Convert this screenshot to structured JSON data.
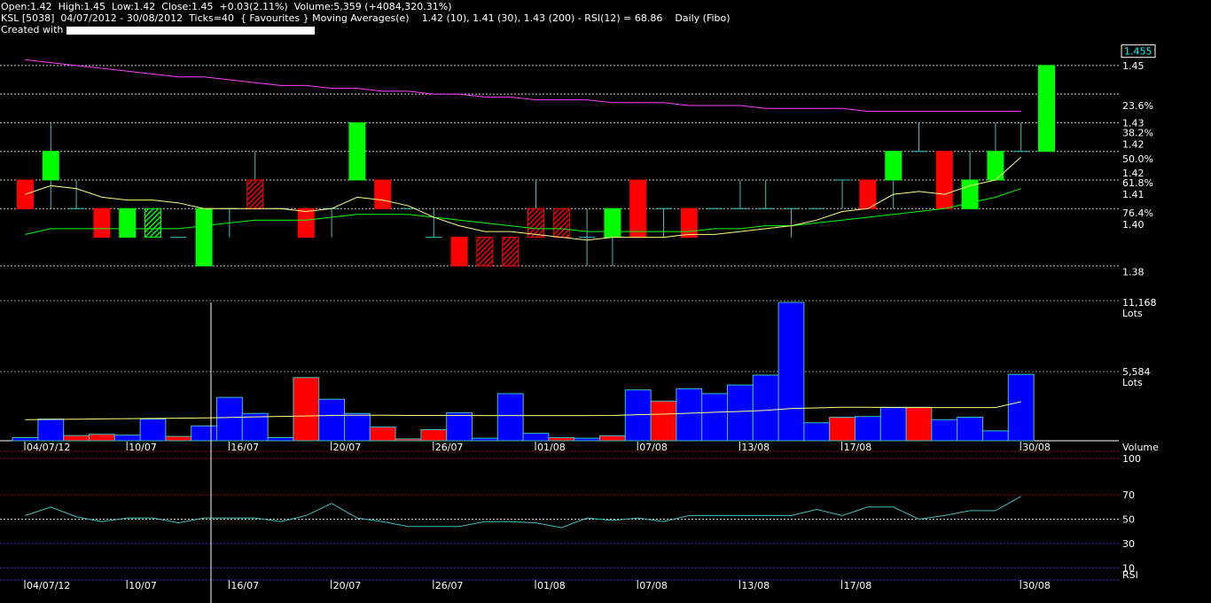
{
  "header": {
    "line1": "Open:1.42  High:1.45  Low:1.42  Close:1.45  +0.03(2.11%)  Volume:5,359 (+4084,320.31%)",
    "line2": "KSL [5038]  04/07/2012 - 30/08/2012  Ticks=40  { Favourites } Moving Averages(e)    1.42 (10), 1.41 (30), 1.43 (200) - RSI(12) = 68.86    Daily (Fibo)",
    "line3": "Created with"
  },
  "colors": {
    "up": "#00ff00",
    "down": "#ff0000",
    "up_vol": "#0000ff",
    "down_vol": "#ff0000",
    "ma10": "#ffff80",
    "ma30": "#00ff00",
    "ma200": "#ff40ff",
    "rsi": "#40c0c0"
  },
  "chart_data": [
    {
      "type": "candlestick",
      "title": "KSL [5038] Daily (Fibo)",
      "ylim": [
        1.375,
        1.458
      ],
      "current_price_label": "1.455",
      "y_labels": [
        {
          "text": "1.45",
          "value": 1.45
        },
        {
          "text": "23.6%",
          "value": 1.436
        },
        {
          "text": "1.43",
          "value": 1.43
        },
        {
          "text": "38.2%",
          "value": 1.4265
        },
        {
          "text": "1.42",
          "value": 1.4225
        },
        {
          "text": "50.0%",
          "value": 1.4175
        },
        {
          "text": "1.42",
          "value": 1.4125
        },
        {
          "text": "61.8%",
          "value": 1.409
        },
        {
          "text": "1.41",
          "value": 1.405
        },
        {
          "text": "76.4%",
          "value": 1.3985
        },
        {
          "text": "1.40",
          "value": 1.3945
        },
        {
          "text": "1.38",
          "value": 1.378
        }
      ],
      "fibo_levels": [
        1.45,
        1.44,
        1.43,
        1.42,
        1.41,
        1.4,
        1.38
      ],
      "candles": [
        {
          "o": 1.41,
          "h": 1.41,
          "l": 1.4,
          "c": 1.4,
          "dir": "down",
          "fill": "solid"
        },
        {
          "o": 1.41,
          "h": 1.43,
          "l": 1.4,
          "c": 1.42,
          "dir": "up",
          "fill": "solid"
        },
        {
          "o": 1.4,
          "h": 1.41,
          "l": 1.4,
          "c": 1.4,
          "dir": "flat"
        },
        {
          "o": 1.4,
          "h": 1.4,
          "l": 1.39,
          "c": 1.39,
          "dir": "down",
          "fill": "solid"
        },
        {
          "o": 1.39,
          "h": 1.4,
          "l": 1.39,
          "c": 1.4,
          "dir": "up",
          "fill": "solid"
        },
        {
          "o": 1.39,
          "h": 1.4,
          "l": 1.39,
          "c": 1.4,
          "dir": "up",
          "fill": "hatched"
        },
        {
          "o": 1.39,
          "h": 1.39,
          "l": 1.39,
          "c": 1.39,
          "dir": "flat"
        },
        {
          "o": 1.38,
          "h": 1.4,
          "l": 1.38,
          "c": 1.4,
          "dir": "up",
          "fill": "solid"
        },
        {
          "o": 1.4,
          "h": 1.4,
          "l": 1.39,
          "c": 1.4,
          "dir": "flat"
        },
        {
          "o": 1.41,
          "h": 1.42,
          "l": 1.4,
          "c": 1.4,
          "dir": "down",
          "fill": "hatched"
        },
        {
          "o": 1.4,
          "h": 1.4,
          "l": 1.4,
          "c": 1.4,
          "dir": "flat"
        },
        {
          "o": 1.4,
          "h": 1.4,
          "l": 1.39,
          "c": 1.39,
          "dir": "down",
          "fill": "solid"
        },
        {
          "o": 1.4,
          "h": 1.4,
          "l": 1.39,
          "c": 1.4,
          "dir": "flat"
        },
        {
          "o": 1.41,
          "h": 1.43,
          "l": 1.41,
          "c": 1.43,
          "dir": "up",
          "fill": "solid"
        },
        {
          "o": 1.41,
          "h": 1.41,
          "l": 1.4,
          "c": 1.4,
          "dir": "down",
          "fill": "solid"
        },
        {
          "o": 1.4,
          "h": 1.4,
          "l": 1.4,
          "c": 1.4,
          "dir": "flat"
        },
        {
          "o": 1.39,
          "h": 1.4,
          "l": 1.39,
          "c": 1.39,
          "dir": "flat"
        },
        {
          "o": 1.39,
          "h": 1.39,
          "l": 1.38,
          "c": 1.38,
          "dir": "down",
          "fill": "solid"
        },
        {
          "o": 1.39,
          "h": 1.39,
          "l": 1.38,
          "c": 1.38,
          "dir": "down",
          "fill": "hatched"
        },
        {
          "o": 1.39,
          "h": 1.39,
          "l": 1.38,
          "c": 1.38,
          "dir": "down",
          "fill": "hatched"
        },
        {
          "o": 1.4,
          "h": 1.41,
          "l": 1.39,
          "c": 1.39,
          "dir": "down",
          "fill": "hatched"
        },
        {
          "o": 1.4,
          "h": 1.4,
          "l": 1.39,
          "c": 1.39,
          "dir": "down",
          "fill": "hatched"
        },
        {
          "o": 1.39,
          "h": 1.4,
          "l": 1.38,
          "c": 1.39,
          "dir": "flat"
        },
        {
          "o": 1.39,
          "h": 1.4,
          "l": 1.38,
          "c": 1.4,
          "dir": "up",
          "fill": "solid"
        },
        {
          "o": 1.41,
          "h": 1.41,
          "l": 1.39,
          "c": 1.39,
          "dir": "down",
          "fill": "solid"
        },
        {
          "o": 1.4,
          "h": 1.4,
          "l": 1.39,
          "c": 1.4,
          "dir": "flat"
        },
        {
          "o": 1.4,
          "h": 1.4,
          "l": 1.39,
          "c": 1.39,
          "dir": "down",
          "fill": "solid"
        },
        {
          "o": 1.4,
          "h": 1.4,
          "l": 1.4,
          "c": 1.4,
          "dir": "flat"
        },
        {
          "o": 1.4,
          "h": 1.41,
          "l": 1.4,
          "c": 1.4,
          "dir": "flat"
        },
        {
          "o": 1.4,
          "h": 1.41,
          "l": 1.4,
          "c": 1.4,
          "dir": "flat"
        },
        {
          "o": 1.4,
          "h": 1.4,
          "l": 1.39,
          "c": 1.4,
          "dir": "flat"
        },
        {
          "o": 1.4,
          "h": 1.4,
          "l": 1.4,
          "c": 1.4,
          "dir": "flat"
        },
        {
          "o": 1.41,
          "h": 1.41,
          "l": 1.4,
          "c": 1.41,
          "dir": "flat"
        },
        {
          "o": 1.41,
          "h": 1.41,
          "l": 1.4,
          "c": 1.4,
          "dir": "down",
          "fill": "solid"
        },
        {
          "o": 1.41,
          "h": 1.42,
          "l": 1.4,
          "c": 1.42,
          "dir": "up",
          "fill": "solid"
        },
        {
          "o": 1.42,
          "h": 1.43,
          "l": 1.42,
          "c": 1.42,
          "dir": "flat"
        },
        {
          "o": 1.42,
          "h": 1.42,
          "l": 1.4,
          "c": 1.4,
          "dir": "down",
          "fill": "solid"
        },
        {
          "o": 1.4,
          "h": 1.42,
          "l": 1.4,
          "c": 1.41,
          "dir": "up",
          "fill": "solid"
        },
        {
          "o": 1.41,
          "h": 1.43,
          "l": 1.41,
          "c": 1.42,
          "dir": "up",
          "fill": "solid"
        },
        {
          "o": 1.42,
          "h": 1.43,
          "l": 1.42,
          "c": 1.42,
          "dir": "flat"
        },
        {
          "o": 1.42,
          "h": 1.45,
          "l": 1.42,
          "c": 1.45,
          "dir": "up",
          "fill": "solid"
        }
      ],
      "ma10": [
        1.405,
        1.408,
        1.407,
        1.404,
        1.403,
        1.403,
        1.402,
        1.4,
        1.4,
        1.4,
        1.4,
        1.399,
        1.4,
        1.404,
        1.403,
        1.401,
        1.397,
        1.394,
        1.392,
        1.392,
        1.391,
        1.39,
        1.389,
        1.39,
        1.39,
        1.39,
        1.391,
        1.391,
        1.392,
        1.393,
        1.394,
        1.396,
        1.399,
        1.4,
        1.405,
        1.406,
        1.405,
        1.408,
        1.41,
        1.418
      ],
      "ma30": [
        1.391,
        1.393,
        1.393,
        1.393,
        1.393,
        1.393,
        1.393,
        1.394,
        1.395,
        1.396,
        1.396,
        1.396,
        1.397,
        1.398,
        1.398,
        1.398,
        1.397,
        1.396,
        1.395,
        1.394,
        1.393,
        1.393,
        1.392,
        1.392,
        1.392,
        1.392,
        1.392,
        1.393,
        1.393,
        1.394,
        1.394,
        1.395,
        1.396,
        1.397,
        1.398,
        1.399,
        1.4,
        1.402,
        1.404,
        1.407
      ],
      "ma200": [
        1.452,
        1.451,
        1.45,
        1.449,
        1.448,
        1.447,
        1.446,
        1.446,
        1.445,
        1.444,
        1.443,
        1.443,
        1.442,
        1.442,
        1.441,
        1.441,
        1.44,
        1.44,
        1.439,
        1.439,
        1.438,
        1.438,
        1.438,
        1.437,
        1.437,
        1.437,
        1.436,
        1.436,
        1.436,
        1.435,
        1.435,
        1.435,
        1.435,
        1.434,
        1.434,
        1.434,
        1.434,
        1.434,
        1.434,
        1.434
      ]
    },
    {
      "type": "bar",
      "title": "Volume",
      "unit": "Lots",
      "ylim": [
        0,
        11168
      ],
      "y_labels": [
        {
          "text": "11,168",
          "value": 11168
        },
        {
          "text": "5,584",
          "value": 5584
        }
      ],
      "values": [
        250,
        1750,
        420,
        520,
        450,
        1750,
        350,
        1200,
        3500,
        2200,
        250,
        5100,
        3350,
        2200,
        1100,
        150,
        900,
        2250,
        200,
        3800,
        600,
        250,
        200,
        400,
        4100,
        3200,
        4200,
        3800,
        4500,
        5300,
        11168,
        1450,
        1900,
        1950,
        2700,
        2700,
        1700,
        1900,
        800,
        5359
      ],
      "directions": [
        "up",
        "up",
        "down",
        "down",
        "up",
        "up",
        "down",
        "up",
        "up",
        "up",
        "up",
        "down",
        "up",
        "up",
        "down",
        "down",
        "down",
        "up",
        "up",
        "up",
        "up",
        "down",
        "up",
        "down",
        "up",
        "down",
        "up",
        "up",
        "up",
        "up",
        "up",
        "up",
        "down",
        "up",
        "up",
        "down",
        "up",
        "up",
        "up",
        "up"
      ],
      "ma": [
        1700,
        1720,
        1740,
        1760,
        1780,
        1800,
        1820,
        1840,
        1880,
        1920,
        1960,
        2000,
        2040,
        2060,
        2060,
        2040,
        2040,
        2040,
        2030,
        2030,
        2030,
        2030,
        2030,
        2040,
        2100,
        2150,
        2220,
        2300,
        2360,
        2450,
        2600,
        2650,
        2700,
        2700,
        2680,
        2680,
        2680,
        2680,
        2680,
        3150
      ]
    },
    {
      "type": "line",
      "title": "RSI",
      "ylim": [
        0,
        100
      ],
      "y_labels": [
        {
          "text": "100",
          "value": 100
        },
        {
          "text": "70",
          "value": 70
        },
        {
          "text": "50",
          "value": 50
        },
        {
          "text": "30",
          "value": 30
        },
        {
          "text": "10",
          "value": 10
        }
      ],
      "values": [
        53,
        60,
        52,
        48,
        51,
        51,
        47,
        51,
        51,
        51,
        48,
        53,
        63,
        51,
        48,
        44,
        44,
        44,
        48,
        48,
        47,
        43,
        51,
        49,
        51,
        48,
        53,
        53,
        53,
        53,
        53,
        58,
        53,
        60,
        60,
        50,
        53,
        57,
        57,
        68.86
      ]
    }
  ],
  "x_axis": {
    "dates": [
      "04/07/12",
      "10/07",
      "16/07",
      "20/07",
      "26/07",
      "01/08",
      "07/08",
      "13/08",
      "17/08",
      "30/08"
    ],
    "date_index": [
      0,
      4,
      8,
      12,
      16,
      20,
      24,
      28,
      32,
      39
    ]
  },
  "panel_labels": {
    "volume": "Volume",
    "volume_unit": "Lots",
    "rsi": "RSI"
  }
}
